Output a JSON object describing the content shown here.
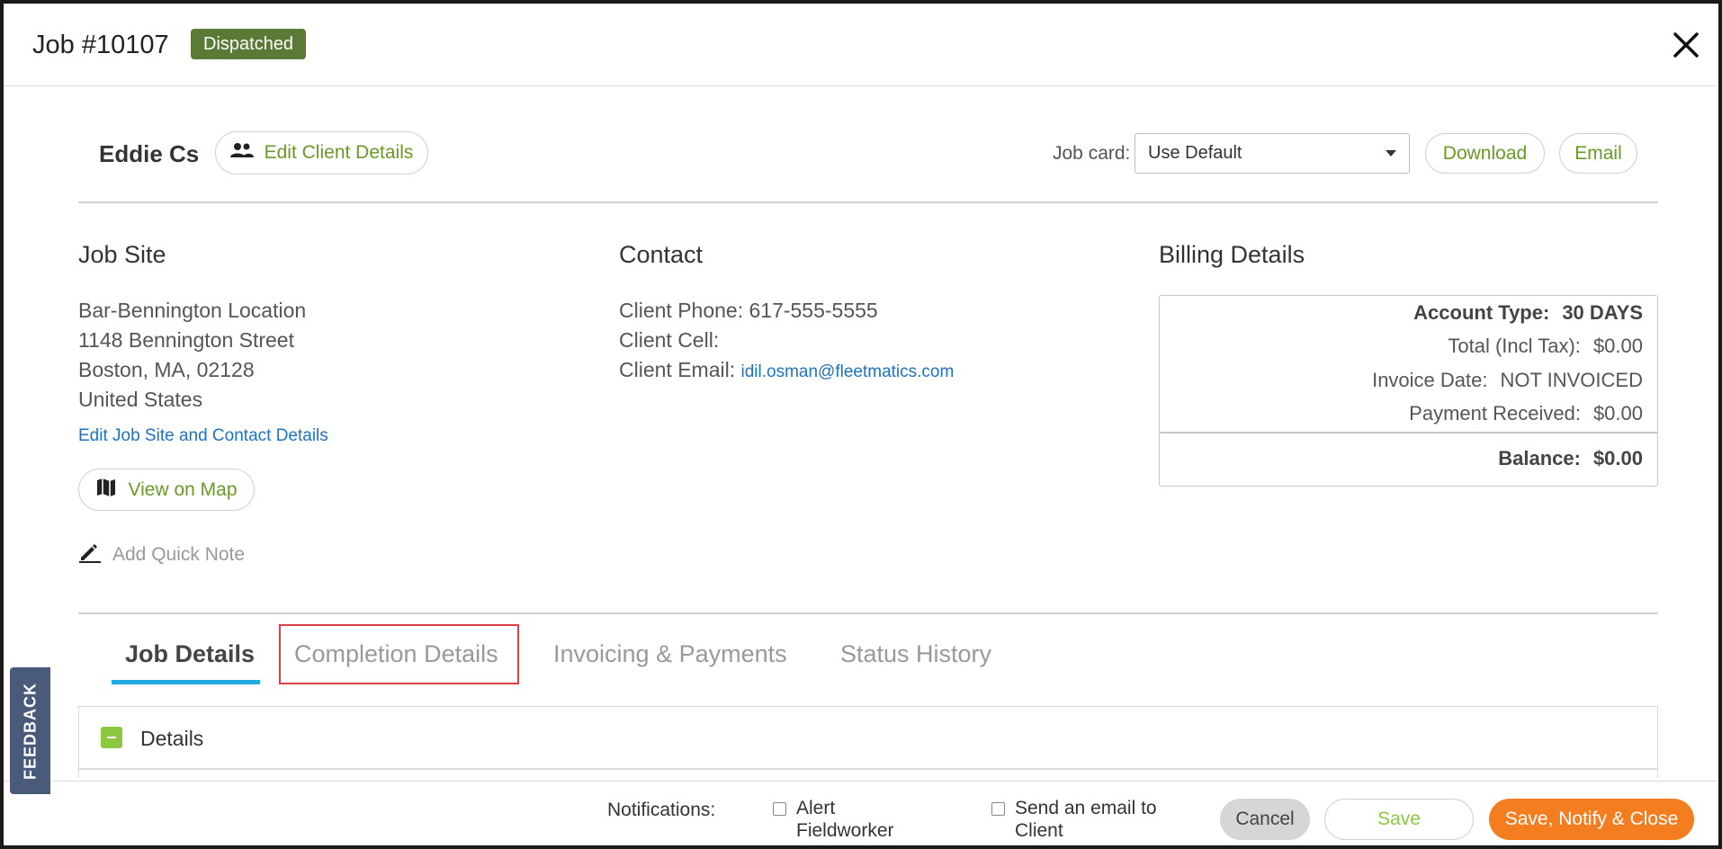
{
  "header": {
    "job_title": "Job #10107",
    "status": "Dispatched",
    "status_color": "#5b7a35"
  },
  "client": {
    "name": "Eddie Cs",
    "edit_label": "Edit Client Details"
  },
  "job_card": {
    "label": "Job card:",
    "selected": "Use Default",
    "download_label": "Download",
    "email_label": "Email"
  },
  "job_site": {
    "heading": "Job Site",
    "lines": [
      "Bar-Bennington Location",
      "1148 Bennington Street",
      "Boston, MA, 02128",
      "United States"
    ],
    "edit_link": "Edit Job Site and Contact Details",
    "map_label": "View on Map",
    "quick_note": "Add Quick Note"
  },
  "contact": {
    "heading": "Contact",
    "phone_label": "Client Phone:",
    "phone": "617-555-5555",
    "cell_label": "Client Cell:",
    "email_label": "Client Email:",
    "email": "idil.osman@fleetmatics.com"
  },
  "billing": {
    "heading": "Billing Details",
    "account_type_label": "Account Type:",
    "account_type": "30 DAYS",
    "total_label": "Total (Incl Tax):",
    "total": "$0.00",
    "invoice_date_label": "Invoice Date:",
    "invoice_date": "NOT INVOICED",
    "payment_label": "Payment Received:",
    "payment": "$0.00",
    "balance_label": "Balance:",
    "balance": "$0.00"
  },
  "tabs": [
    {
      "label": "Job Details",
      "active": true
    },
    {
      "label": "Completion Details",
      "active": false
    },
    {
      "label": "Invoicing & Payments",
      "active": false
    },
    {
      "label": "Status History",
      "active": false
    }
  ],
  "details_panel": {
    "label": "Details"
  },
  "footer": {
    "notifications_label": "Notifications:",
    "alert_line1": "Alert",
    "alert_line2": "Fieldworker",
    "email_line1": "Send an email to",
    "email_line2": "Client",
    "cancel_label": "Cancel",
    "save_label": "Save",
    "save_notify_label": "Save, Notify & Close"
  },
  "feedback_label": "FEEDBACK",
  "colors": {
    "accent_green": "#6a9a25",
    "link_blue": "#1d73c2",
    "tab_underline": "#21a9e1",
    "primary_orange": "#f47d20",
    "highlight_red": "#e04048"
  }
}
